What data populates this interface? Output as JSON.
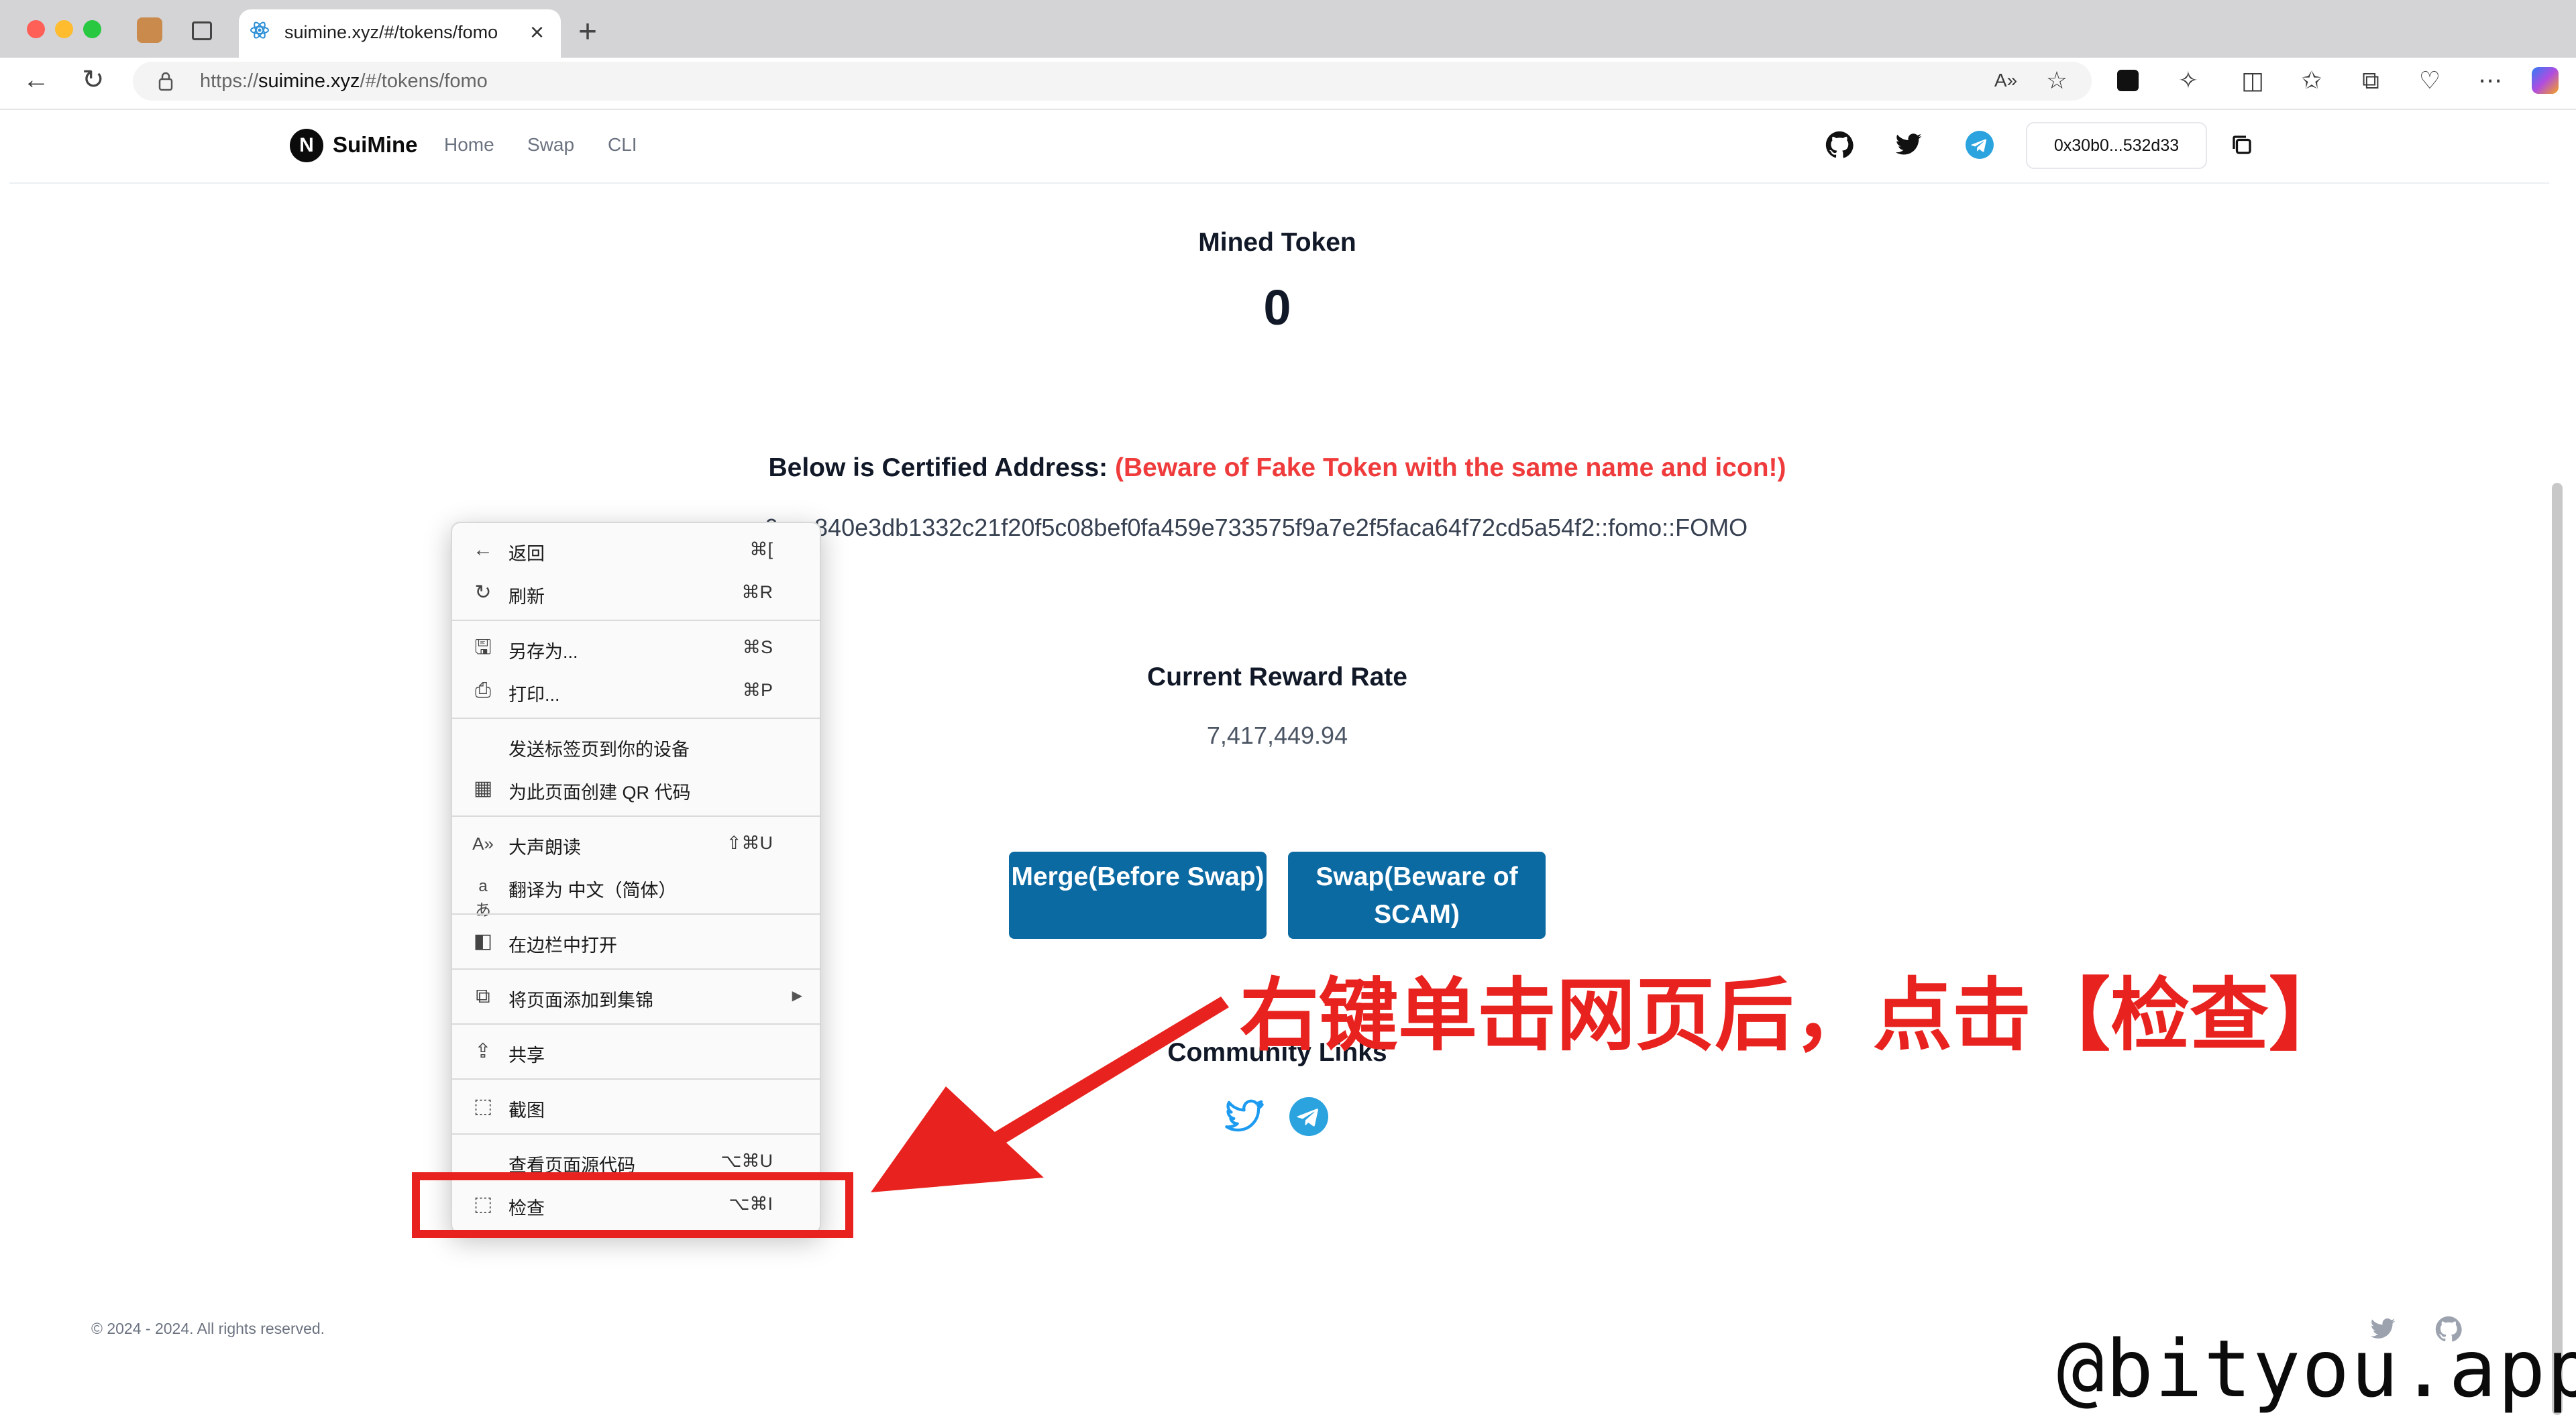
{
  "browser": {
    "tab_title": "suimine.xyz/#/tokens/fomo",
    "url_prefix": "https://",
    "url_host": "suimine.xyz",
    "url_path": "/#/tokens/fomo"
  },
  "header": {
    "logo_letter": "N",
    "brand": "SuiMine",
    "nav": [
      "Home",
      "Swap",
      "CLI"
    ],
    "wallet": "0x30b0...532d33"
  },
  "main": {
    "mined_label": "Mined Token",
    "mined_value": "0",
    "cert_label": "Below is Certified Address:",
    "cert_warning": "(Beware of Fake Token with the same name and icon!)",
    "address": "0x…840e3db1332c21f20f5c08bef0fa459e733575f9a7e2f5faca64f72cd5a54f2::fomo::FOMO",
    "rate_label": "Current Reward Rate",
    "rate_value": "7,417,449.94",
    "buttons": [
      "Merge(Before Swap)",
      "Swap(Beware of SCAM)"
    ],
    "community_label": "Community Links"
  },
  "footer": {
    "copyright": "© 2024 - 2024. All rights reserved."
  },
  "context_menu": {
    "items": [
      {
        "label": "返回",
        "shortcut": "⌘["
      },
      {
        "label": "刷新",
        "shortcut": "⌘R"
      },
      {
        "label": "另存为...",
        "shortcut": "⌘S"
      },
      {
        "label": "打印...",
        "shortcut": "⌘P"
      },
      {
        "label": "发送标签页到你的设备",
        "shortcut": ""
      },
      {
        "label": "为此页面创建 QR 代码",
        "shortcut": ""
      },
      {
        "label": "大声朗读",
        "shortcut": "⇧⌘U"
      },
      {
        "label": "翻译为 中文（简体）",
        "shortcut": ""
      },
      {
        "label": "在边栏中打开",
        "shortcut": ""
      },
      {
        "label": "将页面添加到集锦",
        "shortcut": ""
      },
      {
        "label": "共享",
        "shortcut": ""
      },
      {
        "label": "截图",
        "shortcut": ""
      },
      {
        "label": "查看页面源代码",
        "shortcut": "⌥⌘U"
      },
      {
        "label": "检查",
        "shortcut": "⌥⌘I"
      }
    ]
  },
  "annotation": {
    "callout": "右键单击网页后，点击【检查】",
    "watermark": "@bityou.app"
  },
  "colors": {
    "accent_button": "#0c6aa3",
    "warning": "#ef3b3b",
    "annotation_red": "#e8221e",
    "telegram": "#2aa3df",
    "twitter": "#1d9bf0"
  }
}
